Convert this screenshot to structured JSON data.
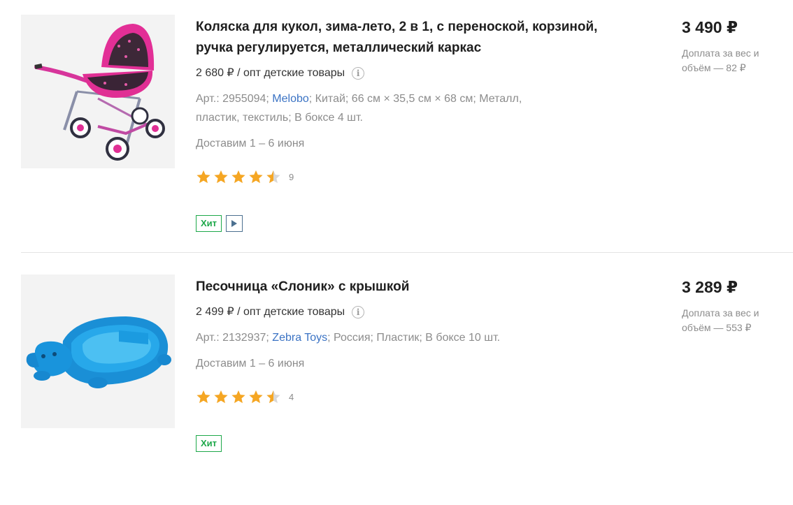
{
  "products": [
    {
      "title": "Коляска для кукол, зима-лето, 2 в 1, с переноской, корзиной, ручка регулируется, металлический каркас",
      "wholesale": "2 680 ₽ / опт детские товары",
      "art_label": "Арт.: 2955094; ",
      "brand": "Melobo",
      "attrs_rest": "; Китай; 66 см × 35,5 см × 68 см; Металл, пластик, текстиль; В боксе 4 шт.",
      "delivery": "Доставим 1 – 6 июня",
      "rating": 4.5,
      "reviews": "9",
      "badge": "Хит",
      "has_video_icon": true,
      "price": "3 490 ₽",
      "surcharge": "Доплата за вес и объём — 82 ₽",
      "image_icon": "doll-stroller-image"
    },
    {
      "title": "Песочница «Слоник» с крышкой",
      "wholesale": "2 499 ₽ / опт детские товары",
      "art_label": "Арт.: 2132937; ",
      "brand": "Zebra Toys",
      "attrs_rest": "; Россия; Пластик; В боксе 10 шт.",
      "delivery": "Доставим 1 – 6 июня",
      "rating": 4.5,
      "reviews": "4",
      "badge": "Хит",
      "has_video_icon": false,
      "price": "3 289 ₽",
      "surcharge": "Доплата за вес и объём — 553 ₽",
      "image_icon": "elephant-sandbox-image"
    }
  ],
  "colors": {
    "star": "#f5a623",
    "star_empty": "#d8d8d8",
    "hit_badge": "#1ea84a",
    "brand_link": "#3b73c4"
  }
}
